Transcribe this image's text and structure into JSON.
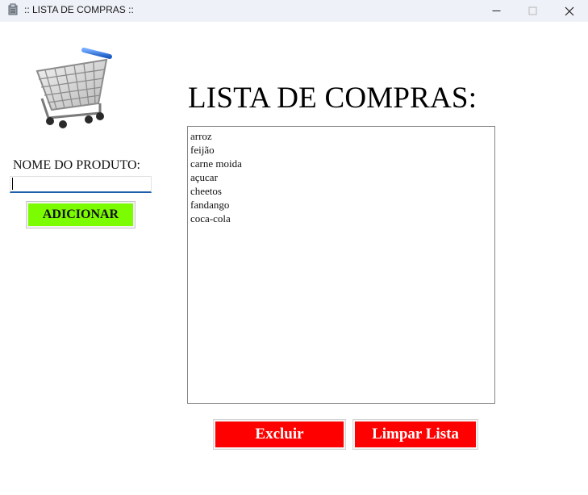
{
  "window": {
    "title": ":: LISTA DE COMPRAS ::",
    "controls": [
      "minimize",
      "maximize",
      "close"
    ]
  },
  "form": {
    "label": "NOME DO PRODUTO:",
    "input_value": "",
    "add_button": "ADICIONAR",
    "add_button_color": "#7cfc00"
  },
  "list": {
    "heading": "LISTA DE COMPRAS:",
    "items": [
      "arroz",
      "feijão",
      "carne moida",
      "açucar",
      "cheetos",
      "fandango",
      "coca-cola"
    ]
  },
  "actions": {
    "delete_button": "Excluir",
    "clear_button": "Limpar Lista",
    "button_color": "#ff0000"
  },
  "icons": {
    "app": "app-icon",
    "cart": "shopping-cart-icon"
  }
}
